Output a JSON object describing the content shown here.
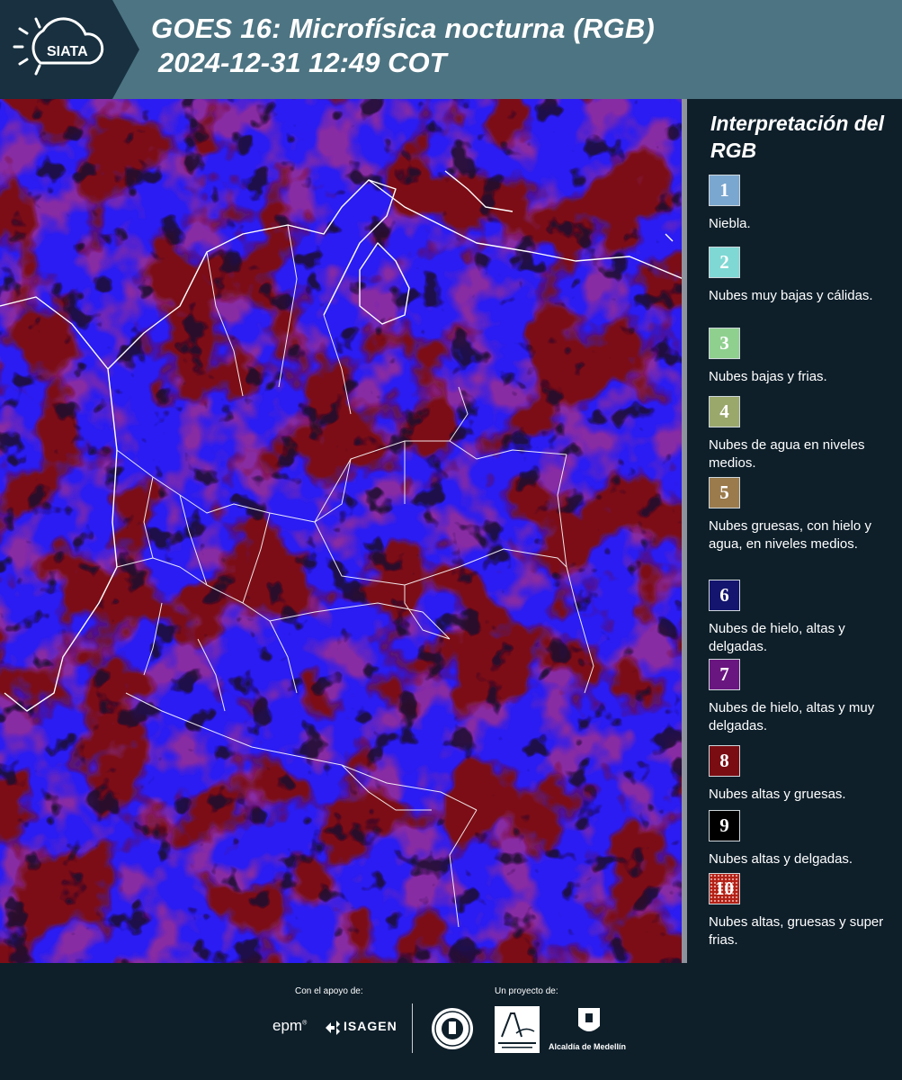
{
  "header": {
    "logo_text": "SIATA",
    "title_line1": "GOES 16: Microfísica nocturna (RGB)",
    "title_line2": "2024-12-31 12:49 COT"
  },
  "legend": {
    "title": "Interpretación del RGB",
    "items": [
      {
        "number": "1",
        "label": "Niebla.",
        "color": "#7aa7cf"
      },
      {
        "number": "2",
        "label": "Nubes muy bajas y cálidas.",
        "color": "#7fd8d4"
      },
      {
        "number": "3",
        "label": "Nubes bajas y frias.",
        "color": "#8fd08f"
      },
      {
        "number": "4",
        "label": "Nubes de agua en niveles medios.",
        "color": "#9aa86c"
      },
      {
        "number": "5",
        "label": "Nubes gruesas, con hielo y agua, en niveles medios.",
        "color": "#9b7b4c"
      },
      {
        "number": "6",
        "label": "Nubes de hielo, altas y delgadas.",
        "color": "#13156e"
      },
      {
        "number": "7",
        "label": "Nubes de hielo, altas y muy delgadas.",
        "color": "#6a1680"
      },
      {
        "number": "8",
        "label": "Nubes altas y gruesas.",
        "color": "#7a0d12"
      },
      {
        "number": "9",
        "label": "Nubes altas y delgadas.",
        "color": "#000000"
      },
      {
        "number": "10",
        "label": "Nubes altas, gruesas y super frias.",
        "color": "#b32015"
      }
    ]
  },
  "footer": {
    "support_label": "Con el apoyo de:",
    "project_label": "Un proyecto de:",
    "sponsors": [
      "epm",
      "ISAGEN"
    ],
    "alcaldia_label": "Alcaldía de Medellín"
  },
  "colors": {
    "header_bg": "#4d7482",
    "panel_bg": "#0e1f2a",
    "map_blue": "#2a1cf2",
    "map_red": "#7c0c14",
    "map_magenta": "#b0307c"
  }
}
